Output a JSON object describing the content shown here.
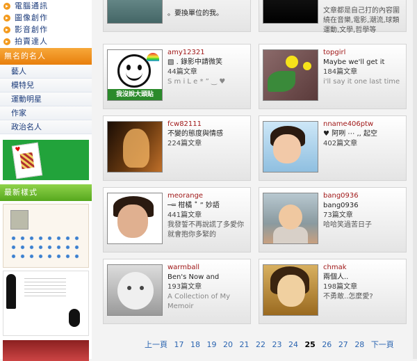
{
  "sidebar": {
    "categories": [
      "電腦通訊",
      "圖像創作",
      "影音創作",
      "拍賣達人"
    ],
    "famous_header": "無名的名人",
    "famous_items": [
      "藝人",
      "模特兒",
      "運動明星",
      "作家",
      "政治名人"
    ],
    "newest_header": "最新樣式"
  },
  "top_partial": [
    {
      "title": "。要換單位的我。"
    },
    {
      "desc": "文章都是自己打的內容圍繞在音樂,電影,潮流,球類運動,文學,哲學等"
    }
  ],
  "tiles": [
    {
      "username": "amy12321",
      "title": "▧ . 錄影中請微笑",
      "count": "44篇文章",
      "desc": "S m i L e * ” ‿ ♥"
    },
    {
      "username": "topgirl",
      "title": "Maybe we'll get it",
      "count": "184篇文章",
      "desc": "i'll say it one last time"
    },
    {
      "username": "fcw82111",
      "title": "不變的態度與情感",
      "count": "224篇文章",
      "desc": ""
    },
    {
      "username": "nname406ptw",
      "title": "♥ 阿咧 ⋯ ,, 起空",
      "count": "402篇文章",
      "desc": ""
    },
    {
      "username": "meorange",
      "title": "─═ 柑橘 ˚ ” 妙語",
      "count": "441篇文章",
      "desc": "我發誓不再說謊了多愛你就會抱你多緊的"
    },
    {
      "username": "bang0936",
      "title": "bang0936",
      "count": "73篇文章",
      "desc": "哈哈笑過苦日子"
    },
    {
      "username": "warmball",
      "title": "Ben's Now and",
      "count": "193篇文章",
      "desc": "A Collection of My Memoir"
    },
    {
      "username": "chmak",
      "title": "兩個人..",
      "count": "198篇文章",
      "desc": "不勇敢..怎麼愛?"
    }
  ],
  "smile_band_text": "我沒說大頭貼",
  "pager": {
    "prev": "上一頁",
    "pages": [
      "17",
      "18",
      "19",
      "20",
      "21",
      "22",
      "23",
      "24",
      "25",
      "26",
      "27",
      "28"
    ],
    "current": "25",
    "next": "下一頁"
  }
}
